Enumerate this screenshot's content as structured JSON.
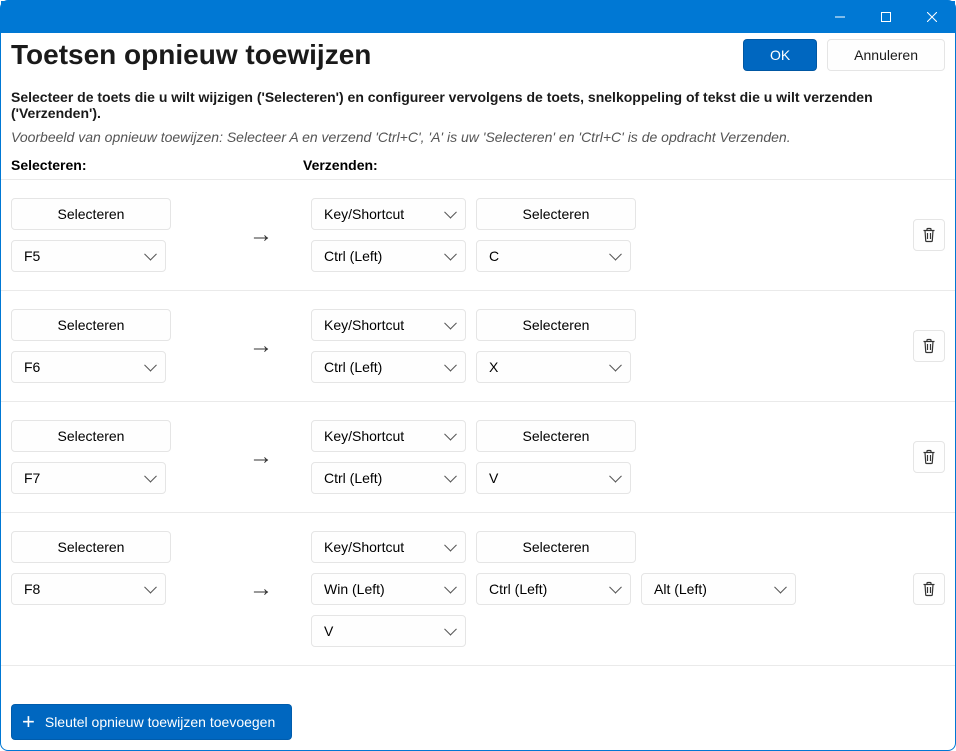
{
  "titlebar": {
    "minimize": "—",
    "maximize": "◻",
    "close": "✕"
  },
  "header": {
    "title": "Toetsen opnieuw toewijzen",
    "ok": "OK",
    "cancel": "Annuleren"
  },
  "instructions": {
    "main": "Selecteer de toets die u wilt wijzigen ('Selecteren') en configureer vervolgens de toets, snelkoppeling of tekst die u wilt verzenden ('Verzenden').",
    "example": "Voorbeeld van opnieuw toewijzen: Selecteer A en verzend 'Ctrl+C', 'A' is uw 'Selecteren' en 'Ctrl+C' is de opdracht Verzenden."
  },
  "columns": {
    "select": "Selecteren:",
    "send": "Verzenden:"
  },
  "labels": {
    "select_btn": "Selecteren",
    "type_key_shortcut": "Key/Shortcut",
    "arrow": "→"
  },
  "rows": [
    {
      "source_key": "F5",
      "send_keys": [
        "Ctrl (Left)",
        "C"
      ]
    },
    {
      "source_key": "F6",
      "send_keys": [
        "Ctrl (Left)",
        "X"
      ]
    },
    {
      "source_key": "F7",
      "send_keys": [
        "Ctrl (Left)",
        "V"
      ]
    },
    {
      "source_key": "F8",
      "send_keys": [
        "Win (Left)",
        "Ctrl (Left)",
        "Alt (Left)",
        "V"
      ]
    }
  ],
  "footer": {
    "add": "Sleutel opnieuw toewijzen toevoegen"
  }
}
